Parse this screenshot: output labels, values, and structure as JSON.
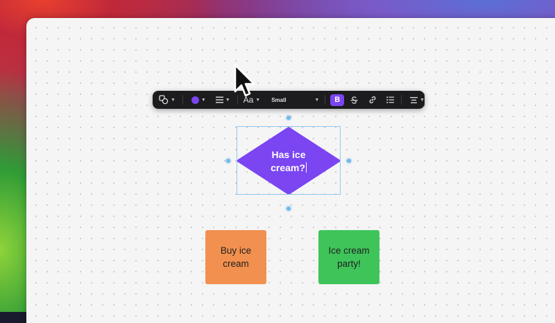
{
  "colors": {
    "fill": "#7b45f2",
    "decision": "#7b45f2",
    "buy_node": "#f2904f",
    "party_node": "#3fc45a",
    "bold_active": "#7b45f2",
    "selection": "#8ec8f0"
  },
  "toolbar": {
    "shape_icon": "shapes-icon",
    "align_icon": "align-lines-icon",
    "font_label": "Aa",
    "size_label": "Small",
    "bold_label": "B",
    "strike_icon": "strikethrough-icon",
    "link_icon": "link-icon",
    "list_icon": "bullet-list-icon",
    "text_align_icon": "text-align-center-icon"
  },
  "nodes": {
    "decision_line1": "Has ice",
    "decision_line2": "cream?",
    "buy_line1": "Buy ice",
    "buy_line2": "cream",
    "party_line1": "Ice cream",
    "party_line2": "party!"
  },
  "cursor": "arrow-cursor-icon"
}
